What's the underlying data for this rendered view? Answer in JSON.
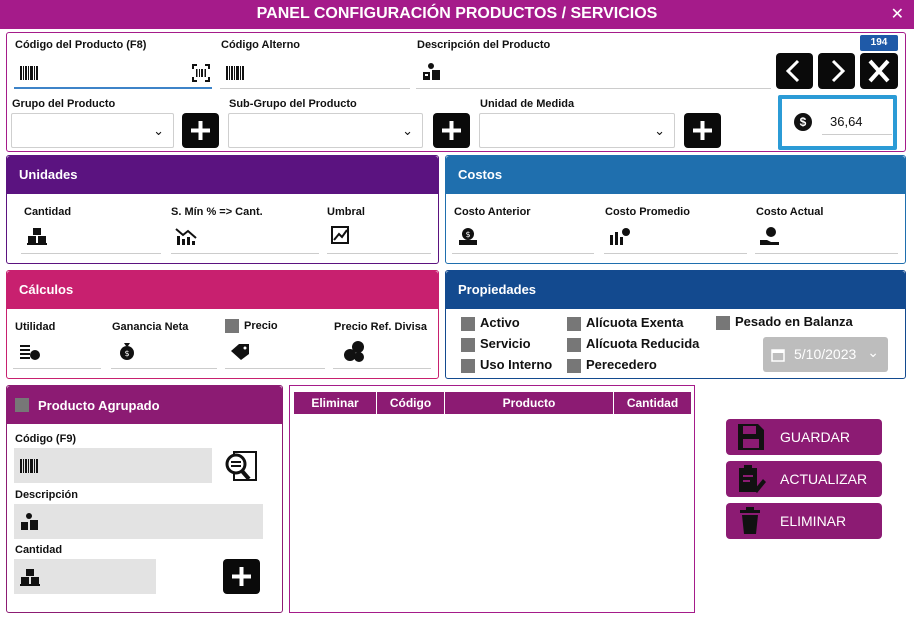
{
  "title": "PANEL CONFIGURACIÓN PRODUCTOS / SERVICIOS",
  "top": {
    "codigo_label": "Código del Producto (F8)",
    "alterno_label": "Código Alterno",
    "descripcion_label": "Descripción del Producto",
    "grupo_label": "Grupo del Producto",
    "subgrupo_label": "Sub-Grupo del Producto",
    "unidad_label": "Unidad de Medida",
    "badge": "194",
    "price_value": "36,64"
  },
  "unidades": {
    "title": "Unidades",
    "cantidad": "Cantidad",
    "smin": "S. Mín % => Cant.",
    "umbral": "Umbral"
  },
  "costos": {
    "title": "Costos",
    "anterior": "Costo Anterior",
    "promedio": "Costo Promedio",
    "actual": "Costo Actual"
  },
  "calculos": {
    "title": "Cálculos",
    "utilidad": "Utilidad",
    "ganancia": "Ganancia Neta",
    "precio": "Precio",
    "precio_ref": "Precio Ref. Divisa"
  },
  "propiedades": {
    "title": "Propiedades",
    "activo": "Activo",
    "servicio": "Servicio",
    "uso_interno": "Uso Interno",
    "alic_exenta": "Alícuota Exenta",
    "alic_reducida": "Alícuota Reducida",
    "perecedero": "Perecedero",
    "pesado": "Pesado en Balanza",
    "date": "5/10/2023"
  },
  "agrupado": {
    "title": "Producto Agrupado",
    "codigo": "Código (F9)",
    "descripcion": "Descripción",
    "cantidad": "Cantidad"
  },
  "table": {
    "headers": [
      "Eliminar",
      "Código",
      "Producto",
      "Cantidad"
    ]
  },
  "actions": {
    "guardar": "GUARDAR",
    "actualizar": "ACTUALIZAR",
    "eliminar": "ELIMINAR"
  },
  "colors": {
    "title_bar": "#a51b8a",
    "unidades": "#5b1380",
    "costos": "#1f6fae",
    "calculos": "#c8206f",
    "propiedades": "#134a8f",
    "agrupado": "#8c1b73",
    "price_border": "#2b9bd6"
  }
}
